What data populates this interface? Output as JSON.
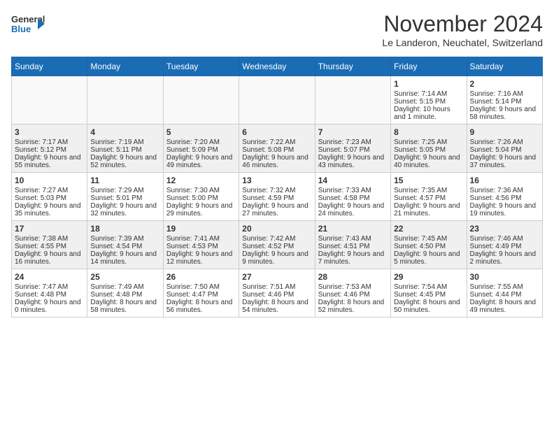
{
  "header": {
    "logo_general": "General",
    "logo_blue": "Blue",
    "month_title": "November 2024",
    "location": "Le Landeron, Neuchatel, Switzerland"
  },
  "calendar": {
    "weekdays": [
      "Sunday",
      "Monday",
      "Tuesday",
      "Wednesday",
      "Thursday",
      "Friday",
      "Saturday"
    ],
    "weeks": [
      [
        {
          "day": "",
          "content": ""
        },
        {
          "day": "",
          "content": ""
        },
        {
          "day": "",
          "content": ""
        },
        {
          "day": "",
          "content": ""
        },
        {
          "day": "",
          "content": ""
        },
        {
          "day": "1",
          "content": "Sunrise: 7:14 AM\nSunset: 5:15 PM\nDaylight: 10 hours and 1 minute."
        },
        {
          "day": "2",
          "content": "Sunrise: 7:16 AM\nSunset: 5:14 PM\nDaylight: 9 hours and 58 minutes."
        }
      ],
      [
        {
          "day": "3",
          "content": "Sunrise: 7:17 AM\nSunset: 5:12 PM\nDaylight: 9 hours and 55 minutes."
        },
        {
          "day": "4",
          "content": "Sunrise: 7:19 AM\nSunset: 5:11 PM\nDaylight: 9 hours and 52 minutes."
        },
        {
          "day": "5",
          "content": "Sunrise: 7:20 AM\nSunset: 5:09 PM\nDaylight: 9 hours and 49 minutes."
        },
        {
          "day": "6",
          "content": "Sunrise: 7:22 AM\nSunset: 5:08 PM\nDaylight: 9 hours and 46 minutes."
        },
        {
          "day": "7",
          "content": "Sunrise: 7:23 AM\nSunset: 5:07 PM\nDaylight: 9 hours and 43 minutes."
        },
        {
          "day": "8",
          "content": "Sunrise: 7:25 AM\nSunset: 5:05 PM\nDaylight: 9 hours and 40 minutes."
        },
        {
          "day": "9",
          "content": "Sunrise: 7:26 AM\nSunset: 5:04 PM\nDaylight: 9 hours and 37 minutes."
        }
      ],
      [
        {
          "day": "10",
          "content": "Sunrise: 7:27 AM\nSunset: 5:03 PM\nDaylight: 9 hours and 35 minutes."
        },
        {
          "day": "11",
          "content": "Sunrise: 7:29 AM\nSunset: 5:01 PM\nDaylight: 9 hours and 32 minutes."
        },
        {
          "day": "12",
          "content": "Sunrise: 7:30 AM\nSunset: 5:00 PM\nDaylight: 9 hours and 29 minutes."
        },
        {
          "day": "13",
          "content": "Sunrise: 7:32 AM\nSunset: 4:59 PM\nDaylight: 9 hours and 27 minutes."
        },
        {
          "day": "14",
          "content": "Sunrise: 7:33 AM\nSunset: 4:58 PM\nDaylight: 9 hours and 24 minutes."
        },
        {
          "day": "15",
          "content": "Sunrise: 7:35 AM\nSunset: 4:57 PM\nDaylight: 9 hours and 21 minutes."
        },
        {
          "day": "16",
          "content": "Sunrise: 7:36 AM\nSunset: 4:56 PM\nDaylight: 9 hours and 19 minutes."
        }
      ],
      [
        {
          "day": "17",
          "content": "Sunrise: 7:38 AM\nSunset: 4:55 PM\nDaylight: 9 hours and 16 minutes."
        },
        {
          "day": "18",
          "content": "Sunrise: 7:39 AM\nSunset: 4:54 PM\nDaylight: 9 hours and 14 minutes."
        },
        {
          "day": "19",
          "content": "Sunrise: 7:41 AM\nSunset: 4:53 PM\nDaylight: 9 hours and 12 minutes."
        },
        {
          "day": "20",
          "content": "Sunrise: 7:42 AM\nSunset: 4:52 PM\nDaylight: 9 hours and 9 minutes."
        },
        {
          "day": "21",
          "content": "Sunrise: 7:43 AM\nSunset: 4:51 PM\nDaylight: 9 hours and 7 minutes."
        },
        {
          "day": "22",
          "content": "Sunrise: 7:45 AM\nSunset: 4:50 PM\nDaylight: 9 hours and 5 minutes."
        },
        {
          "day": "23",
          "content": "Sunrise: 7:46 AM\nSunset: 4:49 PM\nDaylight: 9 hours and 2 minutes."
        }
      ],
      [
        {
          "day": "24",
          "content": "Sunrise: 7:47 AM\nSunset: 4:48 PM\nDaylight: 9 hours and 0 minutes."
        },
        {
          "day": "25",
          "content": "Sunrise: 7:49 AM\nSunset: 4:48 PM\nDaylight: 8 hours and 58 minutes."
        },
        {
          "day": "26",
          "content": "Sunrise: 7:50 AM\nSunset: 4:47 PM\nDaylight: 8 hours and 56 minutes."
        },
        {
          "day": "27",
          "content": "Sunrise: 7:51 AM\nSunset: 4:46 PM\nDaylight: 8 hours and 54 minutes."
        },
        {
          "day": "28",
          "content": "Sunrise: 7:53 AM\nSunset: 4:46 PM\nDaylight: 8 hours and 52 minutes."
        },
        {
          "day": "29",
          "content": "Sunrise: 7:54 AM\nSunset: 4:45 PM\nDaylight: 8 hours and 50 minutes."
        },
        {
          "day": "30",
          "content": "Sunrise: 7:55 AM\nSunset: 4:44 PM\nDaylight: 8 hours and 49 minutes."
        }
      ]
    ]
  }
}
